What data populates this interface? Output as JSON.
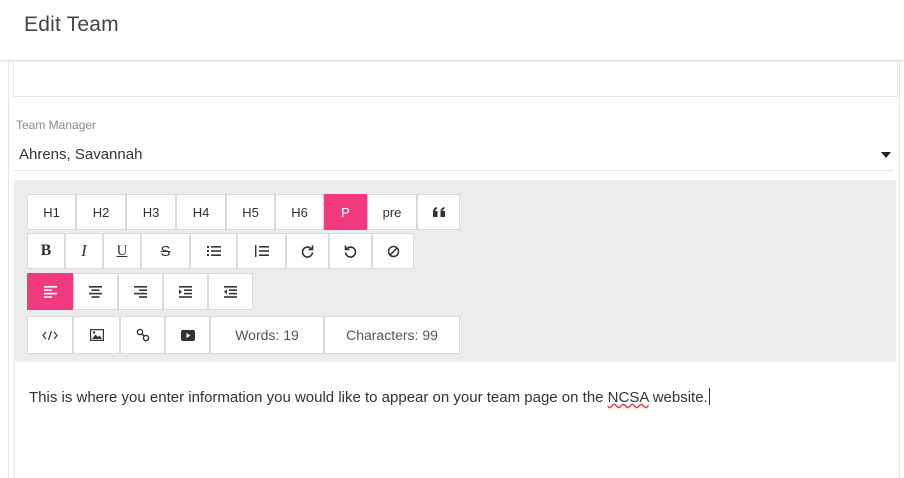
{
  "page": {
    "title": "Edit Team"
  },
  "team_manager": {
    "label": "Team Manager",
    "selected": "Ahrens, Savannah"
  },
  "toolbar": {
    "headings": [
      "H1",
      "H2",
      "H3",
      "H4",
      "H5",
      "H6",
      "P",
      "pre"
    ],
    "quote_icon": "blockquote-icon",
    "bold": "B",
    "italic": "I",
    "underline": "U",
    "strike": "S",
    "format_icons": [
      "unordered-list-icon",
      "ordered-list-icon",
      "redo-icon",
      "undo-icon",
      "clear-format-icon"
    ],
    "align_icons": [
      "align-left-icon",
      "align-center-icon",
      "align-right-icon",
      "indent-icon",
      "outdent-icon"
    ],
    "insert_icons": [
      "code-icon",
      "image-icon",
      "link-icon",
      "video-icon"
    ],
    "words": "Words: 19",
    "characters": "Characters: 99",
    "active_color": "#f23a80"
  },
  "editor": {
    "text_before": "This is where you enter information you would like to appear on your team page on the ",
    "text_link": "NCSA",
    "text_after": " website."
  }
}
